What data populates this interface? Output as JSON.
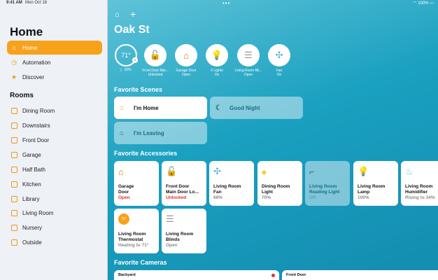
{
  "status_bar": {
    "time": "9:41 AM",
    "date": "Mon Oct 18",
    "battery": "100%"
  },
  "sidebar": {
    "title": "Home",
    "nav": [
      {
        "label": "Home",
        "icon": "house-icon",
        "active": true
      },
      {
        "label": "Automation",
        "icon": "clock-icon",
        "active": false
      },
      {
        "label": "Discover",
        "icon": "star-icon",
        "active": false
      }
    ],
    "rooms_title": "Rooms",
    "rooms": [
      "Dining Room",
      "Downstairs",
      "Front Door",
      "Garage",
      "Half Bath",
      "Kitchen",
      "Library",
      "Living Room",
      "Nursery",
      "Outside"
    ]
  },
  "main": {
    "title": "Oak St",
    "climate": {
      "temperature": "71°",
      "humidity": "20%"
    },
    "quick_status": [
      {
        "line1": "Front Door Mai...",
        "line2": "Unlocked",
        "icon": "lock-open-icon"
      },
      {
        "line1": "Garage Door",
        "line2": "Open",
        "icon": "garage-icon"
      },
      {
        "line1": "6 Lights",
        "line2": "On",
        "icon": "lightbulb-icon"
      },
      {
        "line1": "Living Room Bli...",
        "line2": "Open",
        "icon": "blinds-icon"
      },
      {
        "line1": "Fan",
        "line2": "On",
        "icon": "fan-icon"
      }
    ],
    "scenes_title": "Favorite Scenes",
    "scenes": [
      {
        "label": "I'm Home",
        "active": true
      },
      {
        "label": "Good Night",
        "active": false
      },
      {
        "label": "I'm Leaving",
        "active": false
      }
    ],
    "accessories_title": "Favorite Accessories",
    "accessories": [
      {
        "name1": "Garage",
        "name2": "Door",
        "status": "Open",
        "on": true,
        "alert": true,
        "icon": "garage-icon"
      },
      {
        "name1": "Front Door",
        "name2": "Main Door Lo...",
        "status": "Unlocked",
        "on": true,
        "alert": true,
        "icon": "lock-open-icon"
      },
      {
        "name1": "Living Room",
        "name2": "Fan",
        "status": "68%",
        "on": true,
        "alert": false,
        "icon": "fan-icon"
      },
      {
        "name1": "Dining Room",
        "name2": "Light",
        "status": "70%",
        "on": true,
        "alert": false,
        "icon": "floor-lamp-icon"
      },
      {
        "name1": "Living Room",
        "name2": "Reading Light",
        "status": "Off",
        "on": false,
        "alert": false,
        "icon": "desk-lamp-icon"
      },
      {
        "name1": "Living Room",
        "name2": "Lamp",
        "status": "100%",
        "on": true,
        "alert": false,
        "icon": "lightbulb-icon"
      },
      {
        "name1": "Living Room",
        "name2": "Humidifier",
        "status": "Rising to 34%",
        "on": true,
        "alert": false,
        "icon": "humidifier-icon"
      },
      {
        "name1": "Living Room",
        "name2": "Thermostat",
        "status": "Heating to 71°",
        "on": true,
        "alert": false,
        "icon": "thermostat-icon",
        "badge": "71°"
      },
      {
        "name1": "Living Room",
        "name2": "Blinds",
        "status": "Open",
        "on": true,
        "alert": false,
        "icon": "blinds-icon"
      }
    ],
    "cameras_title": "Favorite Cameras",
    "cameras": [
      "Backyard",
      "Front Door"
    ]
  },
  "colors": {
    "accent": "#f7a21b",
    "alert": "#e0312a",
    "background": "#1aa6c6"
  }
}
